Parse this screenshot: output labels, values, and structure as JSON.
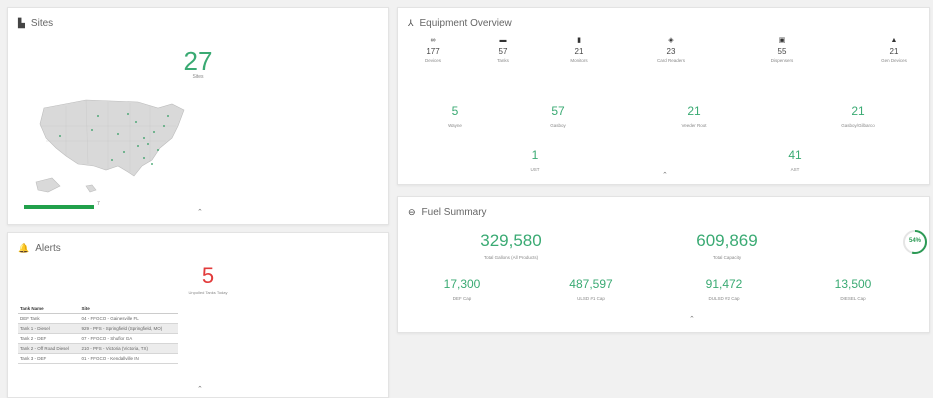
{
  "colors": {
    "accent": "#3aaa73",
    "alert": "#e23b3b",
    "bar": "#21a04b"
  },
  "sites": {
    "title": "Sites",
    "icon": "building-icon",
    "count": "27",
    "count_label": "Sites",
    "bar_label": "7"
  },
  "alerts": {
    "title": "Alerts",
    "icon": "bell-icon",
    "count": "5",
    "count_label": "Unpolled Tanks Today",
    "columns": [
      "Tank Name",
      "Site"
    ],
    "rows": [
      {
        "tank": "DEF Tank",
        "site": "04 - FFGCO - Gainesville FL"
      },
      {
        "tank": "Tank 1 - Diesel",
        "site": "929 - PFS - Springfield (Springfield, MO)"
      },
      {
        "tank": "Tank 2 - DEF",
        "site": "07 - FFGCO - Shuflor GA"
      },
      {
        "tank": "Tank 2 - Off Road Diesel",
        "site": "210 - PFS - Victoria (Victoria, TX)"
      },
      {
        "tank": "Tank 3 - DEF",
        "site": "01 - FFGCO - Kendallville IN"
      }
    ]
  },
  "equipment": {
    "title": "Equipment Overview",
    "icon": "sitemap-icon",
    "top": [
      {
        "icon": "infinity-icon",
        "glyph": "∞",
        "value": "177",
        "label": "Devices"
      },
      {
        "icon": "tank-icon",
        "glyph": "▬",
        "value": "57",
        "label": "Tanks"
      },
      {
        "icon": "chart-icon",
        "glyph": "▮",
        "value": "21",
        "label": "Monitors"
      },
      {
        "icon": "card-reader-icon",
        "glyph": "◈",
        "value": "23",
        "label": "Card Readers"
      },
      {
        "icon": "dispenser-icon",
        "glyph": "▣",
        "value": "55",
        "label": "Dispensers"
      },
      {
        "icon": "gen-device-icon",
        "glyph": "▲",
        "value": "21",
        "label": "Gen Devices"
      }
    ],
    "mid": [
      {
        "value": "5",
        "label": "Wayne"
      },
      {
        "value": "57",
        "label": "Gasboy"
      },
      {
        "value": "21",
        "label": "Veeder Root"
      },
      {
        "value": "21",
        "label": "Gasboy/Gilbarco"
      }
    ],
    "bottom": [
      {
        "value": "1",
        "label": "UST"
      },
      {
        "value": "41",
        "label": "AST"
      }
    ]
  },
  "fuel": {
    "title": "Fuel Summary",
    "icon": "fuel-icon",
    "total_gallons": "329,580",
    "total_gallons_label": "Total Gallons (All Products)",
    "total_capacity": "609,869",
    "total_capacity_label": "Total Capacity",
    "gauge_percent": 54,
    "gauge_label": "54%",
    "caps": [
      {
        "value": "17,300",
        "label": "DEF Cap"
      },
      {
        "value": "487,597",
        "label": "ULSD #1 Cap"
      },
      {
        "value": "91,472",
        "label": "DULSD #2 Cap"
      },
      {
        "value": "13,500",
        "label": "DIESEL Cap"
      }
    ]
  }
}
